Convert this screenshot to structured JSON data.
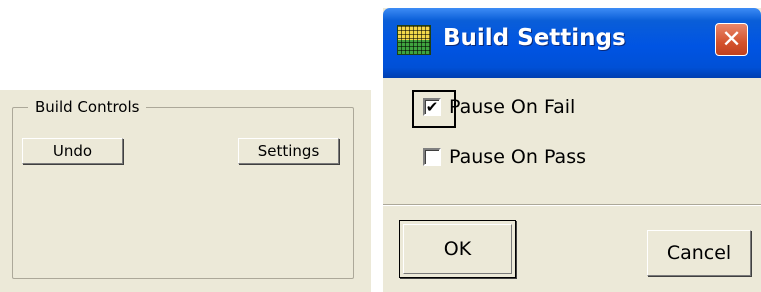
{
  "build_controls": {
    "group_title": "Build Controls",
    "undo_label": "Undo",
    "settings_label": "Settings"
  },
  "dialog": {
    "title": "Build Settings",
    "close_glyph": "✕",
    "options": [
      {
        "label": "Pause On Fail",
        "checked": true
      },
      {
        "label": "Pause On Pass",
        "checked": false
      }
    ],
    "ok_label": "OK",
    "cancel_label": "Cancel",
    "icons": {
      "title_icon": "grid-app-icon",
      "close_icon": "close-icon"
    },
    "colors": {
      "titlebar": "#0054e3",
      "close_button": "#d4522c",
      "face": "#ece9d8"
    }
  }
}
